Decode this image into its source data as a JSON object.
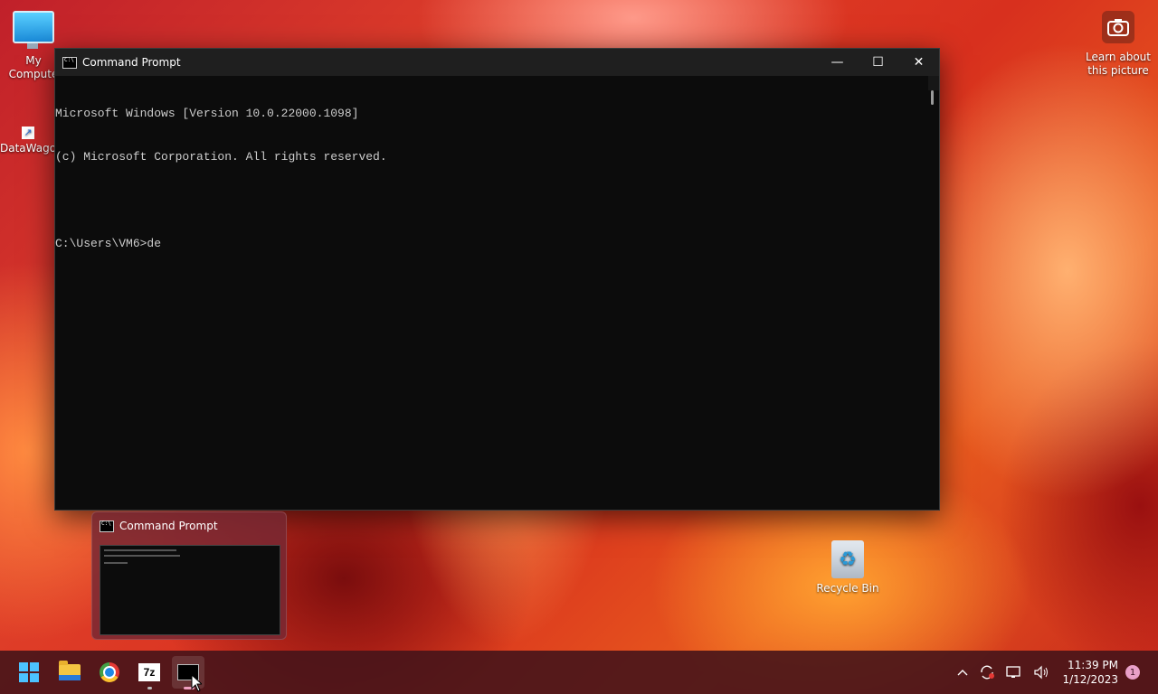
{
  "desktop": {
    "icons": [
      {
        "label": "My\nComputer",
        "short": "My Compute"
      },
      {
        "label": "DataWagon"
      }
    ],
    "spotlight_label_1": "Learn about",
    "spotlight_label_2": "this picture",
    "recycle_bin_label": "Recycle Bin"
  },
  "window": {
    "title": "Command Prompt",
    "minimize_glyph": "—",
    "maximize_glyph": "☐",
    "close_glyph": "✕",
    "console_lines": [
      "Microsoft Windows [Version 10.0.22000.1098]",
      "(c) Microsoft Corporation. All rights reserved.",
      "",
      "C:\\Users\\VM6>de"
    ]
  },
  "taskbar_preview": {
    "title": "Command Prompt"
  },
  "taskbar": {
    "apps": [
      {
        "name": "start-button"
      },
      {
        "name": "file-explorer"
      },
      {
        "name": "google-chrome"
      },
      {
        "name": "7-zip",
        "label": "7z"
      },
      {
        "name": "command-prompt"
      }
    ],
    "clock_time": "11:39 PM",
    "clock_date": "1/12/2023",
    "notification_count": "1"
  }
}
